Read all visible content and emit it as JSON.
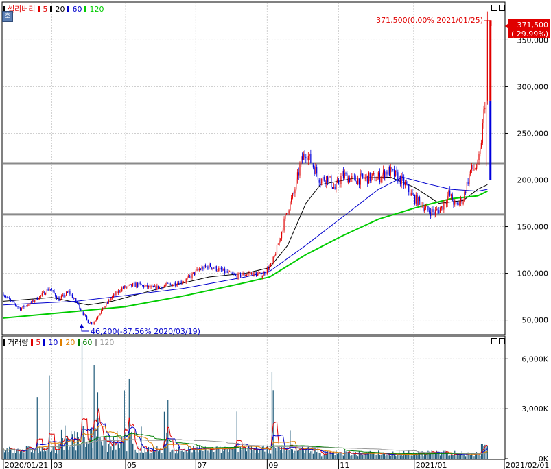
{
  "price_panel": {
    "title": "셀리버리",
    "ma_legend": [
      {
        "label": "5",
        "color": "#e00000"
      },
      {
        "label": "20",
        "color": "#000000"
      },
      {
        "label": "60",
        "color": "#0000cc"
      },
      {
        "label": "120",
        "color": "#00cc00"
      }
    ],
    "side_tab": "호",
    "y_ticks": [
      "350,000",
      "300,000",
      "250,000",
      "200,000",
      "150,000",
      "100,000",
      "50,000"
    ],
    "current_price_badge": [
      "371,500",
      "( 29.99%)"
    ],
    "high_annotation": "371,500(0.00% 2021/01/25)",
    "low_annotation": "46,200(-87.56% 2020/03/19)"
  },
  "volume_panel": {
    "title": "거래량",
    "ma_legend": [
      {
        "label": "5",
        "color": "#e00000"
      },
      {
        "label": "10",
        "color": "#0000cc"
      },
      {
        "label": "20",
        "color": "#e08000"
      },
      {
        "label": "60",
        "color": "#008000"
      },
      {
        "label": "120",
        "color": "#999999"
      }
    ],
    "y_ticks": [
      "6,000K",
      "3,000K",
      "0K"
    ]
  },
  "x_axis": {
    "labels": [
      "2020/01/21",
      "03",
      "05",
      "07",
      "09",
      "11",
      "2021/01",
      "2021/02/01"
    ]
  },
  "chart_data": {
    "type": "candlestick",
    "title": "셀리버리",
    "y_range": [
      35000,
      390000
    ],
    "volume_range_k": [
      0,
      7000
    ],
    "support_lines": [
      163000,
      218000
    ],
    "price_path": [
      [
        0,
        78000
      ],
      [
        6,
        70000
      ],
      [
        14,
        62000
      ],
      [
        22,
        68000
      ],
      [
        30,
        75000
      ],
      [
        38,
        84000
      ],
      [
        46,
        72000
      ],
      [
        54,
        80000
      ],
      [
        62,
        66000
      ],
      [
        70,
        48000
      ],
      [
        74,
        46200
      ],
      [
        80,
        58000
      ],
      [
        88,
        72000
      ],
      [
        98,
        84000
      ],
      [
        110,
        88000
      ],
      [
        124,
        84000
      ],
      [
        138,
        88000
      ],
      [
        150,
        92000
      ],
      [
        162,
        104000
      ],
      [
        170,
        108000
      ],
      [
        180,
        103000
      ],
      [
        192,
        97000
      ],
      [
        204,
        100000
      ],
      [
        214,
        98000
      ],
      [
        222,
        110000
      ],
      [
        228,
        135000
      ],
      [
        234,
        165000
      ],
      [
        240,
        185000
      ],
      [
        246,
        220000
      ],
      [
        250,
        230000
      ],
      [
        256,
        215000
      ],
      [
        262,
        200000
      ],
      [
        268,
        203000
      ],
      [
        274,
        190000
      ],
      [
        280,
        205000
      ],
      [
        290,
        200000
      ],
      [
        300,
        202000
      ],
      [
        310,
        203000
      ],
      [
        318,
        210000
      ],
      [
        326,
        203000
      ],
      [
        332,
        195000
      ],
      [
        338,
        182000
      ],
      [
        344,
        176000
      ],
      [
        350,
        168000
      ],
      [
        356,
        165000
      ],
      [
        362,
        170000
      ],
      [
        368,
        185000
      ],
      [
        374,
        172000
      ],
      [
        380,
        180000
      ],
      [
        386,
        210000
      ],
      [
        392,
        215000
      ],
      [
        394,
        230000
      ],
      [
        398,
        285000
      ],
      [
        400,
        371500
      ]
    ],
    "ma_series": [
      {
        "name": "5",
        "color": "#e00000"
      },
      {
        "name": "20",
        "color": "#000000",
        "points": [
          [
            0,
            70000
          ],
          [
            40,
            74000
          ],
          [
            70,
            66000
          ],
          [
            90,
            70000
          ],
          [
            130,
            84000
          ],
          [
            170,
            96000
          ],
          [
            200,
            100000
          ],
          [
            220,
            106000
          ],
          [
            235,
            130000
          ],
          [
            250,
            175000
          ],
          [
            262,
            195000
          ],
          [
            290,
            202000
          ],
          [
            320,
            203000
          ],
          [
            340,
            192000
          ],
          [
            360,
            175000
          ],
          [
            380,
            178000
          ],
          [
            392,
            190000
          ],
          [
            400,
            195000
          ]
        ]
      },
      {
        "name": "60",
        "color": "#0000cc",
        "points": [
          [
            0,
            66000
          ],
          [
            60,
            70000
          ],
          [
            100,
            76000
          ],
          [
            150,
            84000
          ],
          [
            200,
            96000
          ],
          [
            220,
            102000
          ],
          [
            250,
            130000
          ],
          [
            280,
            160000
          ],
          [
            310,
            190000
          ],
          [
            330,
            203000
          ],
          [
            350,
            196000
          ],
          [
            370,
            190000
          ],
          [
            392,
            188000
          ],
          [
            400,
            190000
          ]
        ]
      },
      {
        "name": "120",
        "color": "#00cc00",
        "points": [
          [
            0,
            52000
          ],
          [
            50,
            58000
          ],
          [
            100,
            64000
          ],
          [
            150,
            76000
          ],
          [
            200,
            90000
          ],
          [
            220,
            96000
          ],
          [
            250,
            120000
          ],
          [
            280,
            140000
          ],
          [
            310,
            158000
          ],
          [
            340,
            170000
          ],
          [
            370,
            180000
          ],
          [
            392,
            183000
          ],
          [
            400,
            188000
          ]
        ]
      }
    ],
    "x_tick_labels": [
      "2020/01/21",
      "03",
      "05",
      "07",
      "09",
      "11",
      "2021/01",
      "2021/02/01"
    ]
  }
}
